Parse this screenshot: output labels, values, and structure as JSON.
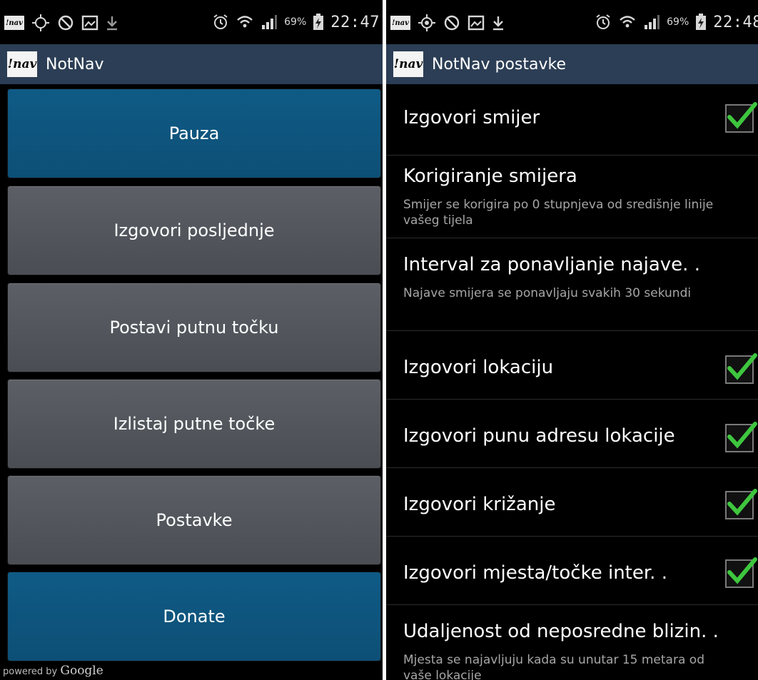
{
  "left_screen": {
    "status_bar": {
      "app_icon_label": "!nav",
      "battery_percent": "69%",
      "time": "22:47"
    },
    "app_bar": {
      "logo_text": "!nav",
      "title": "NotNav"
    },
    "buttons": [
      {
        "label": "Pauza"
      },
      {
        "label": "Izgovori posljednje"
      },
      {
        "label": "Postavi putnu točku"
      },
      {
        "label": "Izlistaj putne točke"
      },
      {
        "label": "Postavke"
      },
      {
        "label": "Donate"
      }
    ],
    "powered_by": {
      "prefix": "powered by",
      "brand": "Google"
    }
  },
  "right_screen": {
    "status_bar": {
      "app_icon_label": "!nav",
      "battery_percent": "69%",
      "time": "22:48"
    },
    "app_bar": {
      "logo_text": "!nav",
      "title": "NotNav postavke"
    },
    "settings": [
      {
        "title": "Izgovori smijer",
        "checked": true
      },
      {
        "title": "Korigiranje smijera",
        "subtitle": "Smijer se korigira po 0 stupnjeva od središnje linije vašeg tijela"
      },
      {
        "title": "Interval za ponavljanje najave. .",
        "subtitle": "Najave smijera se ponavljaju svakih 30 sekundi"
      },
      {
        "title": "Izgovori lokaciju",
        "checked": true
      },
      {
        "title": "Izgovori punu adresu lokacije",
        "checked": true
      },
      {
        "title": "Izgovori križanje",
        "checked": true
      },
      {
        "title": "Izgovori mjesta/točke inter. .",
        "checked": true
      },
      {
        "title": "Udaljenost od neposredne blizin. .",
        "subtitle": "Mjesta se najavljuju kada su unutar 15 metara od vaše lokacije"
      }
    ]
  },
  "colors": {
    "action_bar": "#2c3e55",
    "primary_button": "#0f5b86",
    "secondary_button": "#54585e",
    "check_green": "#3ec63e"
  }
}
